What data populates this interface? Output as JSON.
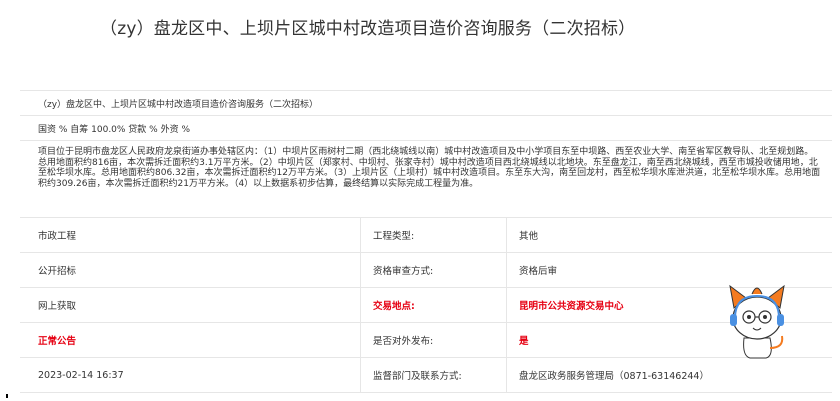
{
  "page": {
    "title": "（zy）盘龙区中、上坝片区城中村改造项目造价咨询服务（二次招标）"
  },
  "details": {
    "project_name": "（zy）盘龙区中、上坝片区城中村改造项目造价咨询服务（二次招标）",
    "funding": "国资 % 自筹 100.0% 贷款 % 外资 %",
    "description": "项目位于昆明市盘龙区人民政府龙泉街道办事处辖区内：（1）中坝片区雨树村二期（西北绕城线以南）城中村改造项目及中小学项目东至中坝路、西至农业大学、南至省军区教导队、北至规划路。总用地面积约816亩，本次需拆迁面积约3.1万平方米。（2）中坝片区（郑家村、中坝村、张家寺村）城中村改造项目西北绕城线以北地块。东至盘龙江，南至西北绕城线，西至市城投收储用地，北至松华坝水库。总用地面积约806.32亩，本次需拆迁面积约12万平方米。（3）上坝片区（上坝村）城中村改造项目。东至东大沟，南至回龙村，西至松华坝水库泄洪道，北至松华坝水库。总用地面积约309.26亩，本次需拆迁面积约21万平方米。（4）以上数据系初步估算，最终结算以实际完成工程量为准。"
  },
  "rows": [
    {
      "c1": "市政工程",
      "c2": "工程类型:",
      "c3": "其他"
    },
    {
      "c1": "公开招标",
      "c2": "资格审查方式:",
      "c3": "资格后审"
    },
    {
      "c1": "网上获取",
      "c2": "交易地点:",
      "c3": "昆明市公共资源交易中心"
    },
    {
      "c1": "正常公告",
      "c2": "是否对外发布:",
      "c3": "是"
    },
    {
      "c1": "2023-02-14 16:37",
      "c2": "监督部门及联系方式:",
      "c3": "盘龙区政务服务管理局（0871-63146244）"
    }
  ],
  "colors": {
    "highlight": "#e60012",
    "border": "#e6e6e6",
    "mascot_accent": "#f47b20"
  },
  "icons": {
    "mascot": "cartoon-mascot-icon"
  }
}
